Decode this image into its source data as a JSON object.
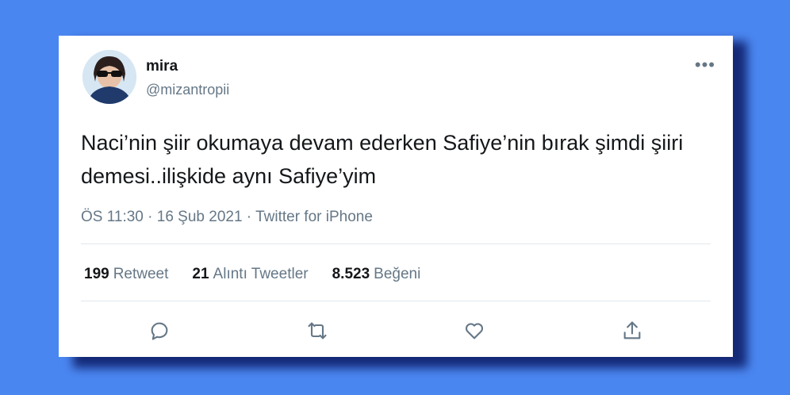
{
  "user": {
    "name": "mira",
    "handle": "@mizantropii"
  },
  "tweet": {
    "text": "Naci’nin şiir okumaya devam ederken Safiye’nin bırak şimdi şiiri demesi..ilişkide aynı  Safiye’yim",
    "time": "ÖS 11:30 · 16 Şub 2021",
    "separator": " · ",
    "source": "Twitter for iPhone"
  },
  "stats": {
    "retweets": "199",
    "retweets_label": "Retweet",
    "quotes": "21",
    "quotes_label": "Alıntı Tweetler",
    "likes": "8.523",
    "likes_label": "Beğeni"
  },
  "more_label": "•••",
  "colors": {
    "background": "#4a86f0",
    "card": "#ffffff",
    "secondary_text": "#657786",
    "primary_text": "#14171a"
  },
  "icons": [
    "more-icon",
    "reply-icon",
    "retweet-icon",
    "like-icon",
    "share-icon"
  ]
}
